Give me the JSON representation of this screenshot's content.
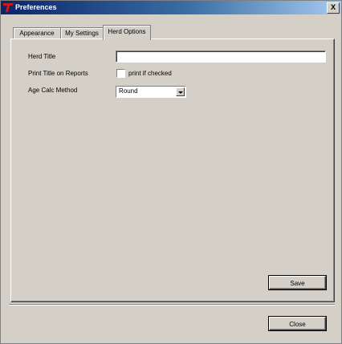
{
  "window": {
    "title": "Preferences",
    "close_label": "X"
  },
  "tabs": [
    {
      "label": "Appearance"
    },
    {
      "label": "My Settings"
    },
    {
      "label": "Herd Options"
    }
  ],
  "herd_options": {
    "herd_title_label": "Herd Title",
    "herd_title_value": "",
    "print_title_label": "Print Title on Reports",
    "print_checkbox_label": "print if checked",
    "print_checked": false,
    "age_calc_label": "Age Calc Method",
    "age_calc_value": "Round"
  },
  "buttons": {
    "save_label": "Save",
    "close_label": "Close"
  },
  "colors": {
    "window_bg": "#d4d0c8",
    "titlebar_start": "#0a246a",
    "titlebar_end": "#a6caf0",
    "logo_red": "#cc1a1a"
  }
}
